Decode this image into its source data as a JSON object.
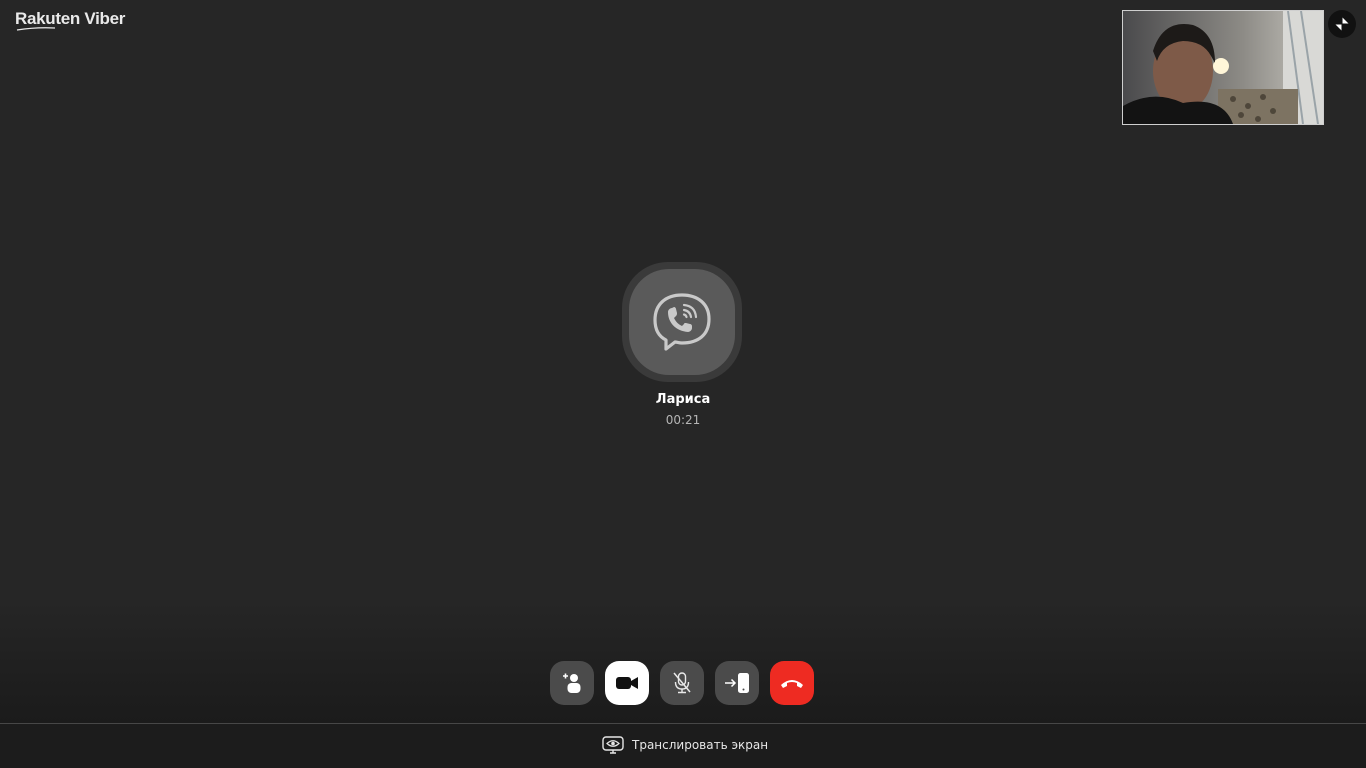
{
  "app": {
    "brand": "Rakuten Viber"
  },
  "call": {
    "contact_name": "Лариса",
    "duration": "00:21",
    "avatar_icon": "viber-logo-icon"
  },
  "controls": [
    {
      "name": "add-participant-button",
      "icon": "add-person-icon",
      "style": "gray"
    },
    {
      "name": "video-toggle-button",
      "icon": "video-camera-icon",
      "style": "white"
    },
    {
      "name": "mute-microphone-button",
      "icon": "microphone-muted-icon",
      "style": "gray"
    },
    {
      "name": "transfer-to-phone-button",
      "icon": "transfer-to-phone-icon",
      "style": "gray"
    },
    {
      "name": "end-call-button",
      "icon": "hang-up-icon",
      "style": "red"
    }
  ],
  "footer": {
    "share_screen_label": "Транслировать экран",
    "share_screen_icon": "eye-screen-icon"
  },
  "colors": {
    "background": "#262626",
    "end_call": "#ee2b22",
    "control_gray": "#4b4b4b",
    "footer": "#1c1c1c"
  }
}
